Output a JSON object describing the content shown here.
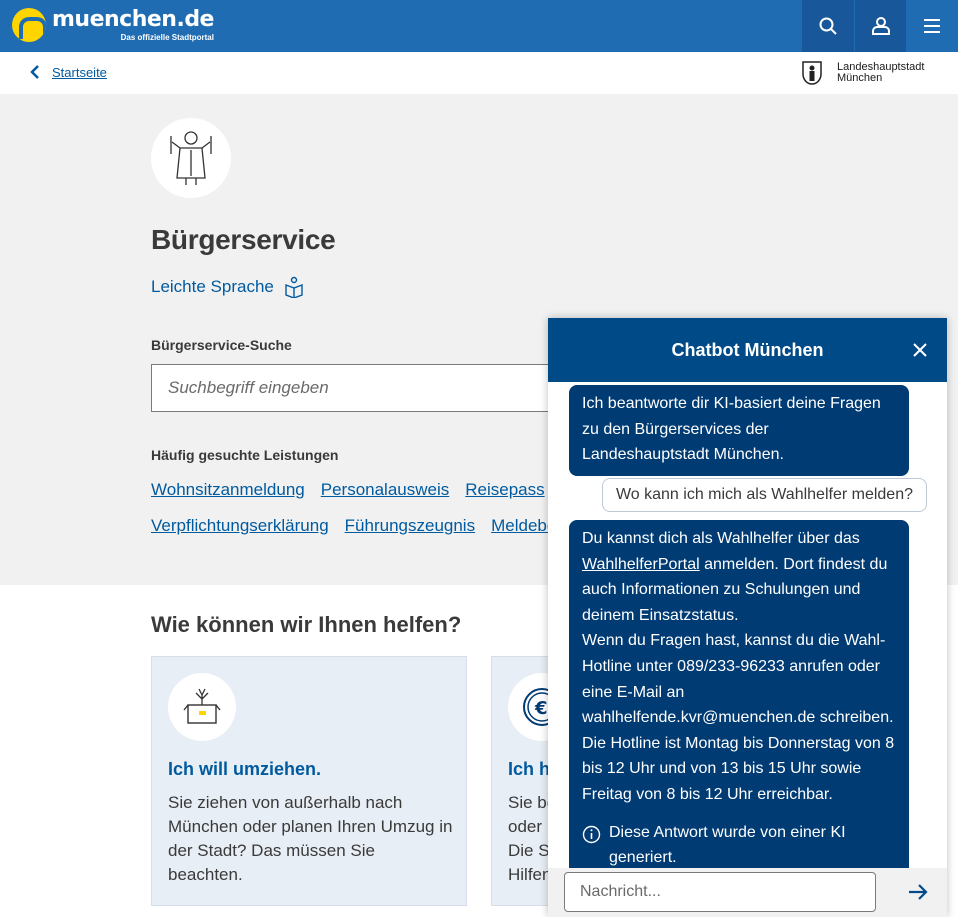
{
  "brand": {
    "name": "muenchen.de",
    "tagline": "Das offizielle Stadtportal"
  },
  "topbar": {
    "icons": [
      "search-icon",
      "user-icon",
      "menu-icon"
    ]
  },
  "breadcrumb": {
    "label": "Startseite"
  },
  "city": {
    "line1": "Landeshauptstadt",
    "line2": "München"
  },
  "page": {
    "title": "Bürgerservice",
    "easy_language": "Leichte Sprache",
    "search_label": "Bürgerservice-Suche",
    "search_placeholder": "Suchbegriff eingeben",
    "frequent_label": "Häufig gesuchte Leistungen",
    "links_row1": [
      "Wohnsitzanmeldung",
      "Personalausweis",
      "Reisepass"
    ],
    "links_row2": [
      "Verpflichtungserklärung",
      "Führungszeugnis",
      "Meldebe"
    ]
  },
  "help": {
    "title": "Wie können wir Ihnen helfen?",
    "cards": [
      {
        "title": "Ich will umziehen.",
        "text": "Sie ziehen von außerhalb nach München oder planen Ihren Umzug in der Stadt? Das müssen Sie beachten."
      },
      {
        "title": "Ich he",
        "text": "Sie be\noder\nDie St\nHilfen"
      }
    ]
  },
  "chat": {
    "title": "Chatbot München",
    "msg1": "Ich beantworte dir KI-basiert deine Fragen zu den Bürgerservices der Landeshauptstadt München.",
    "user_msg": "Wo kann ich mich als Wahlhelfer melden?",
    "msg3_part1": "Du kannst dich als Wahlhelfer über das",
    "msg3_link": "WahlhelferPortal",
    "msg3_part2": " anmelden. Dort findest du auch Informationen zu Schulungen und deinem Einsatzstatus.",
    "msg3_part3": "Wenn du Fragen hast, kannst du die Wahl-Hotline unter 089/233-96233 anrufen oder eine E-Mail an wahlhelfende.kvr@muenchen.de schreiben. Die Hotline ist Montag bis Donnerstag von 8 bis 12 Uhr und von 13 bis 15 Uhr sowie Freitag von 8 bis 12 Uhr erreichbar.",
    "disclaimer": "Diese Antwort wurde von einer KI generiert.",
    "input_placeholder": "Nachricht..."
  }
}
